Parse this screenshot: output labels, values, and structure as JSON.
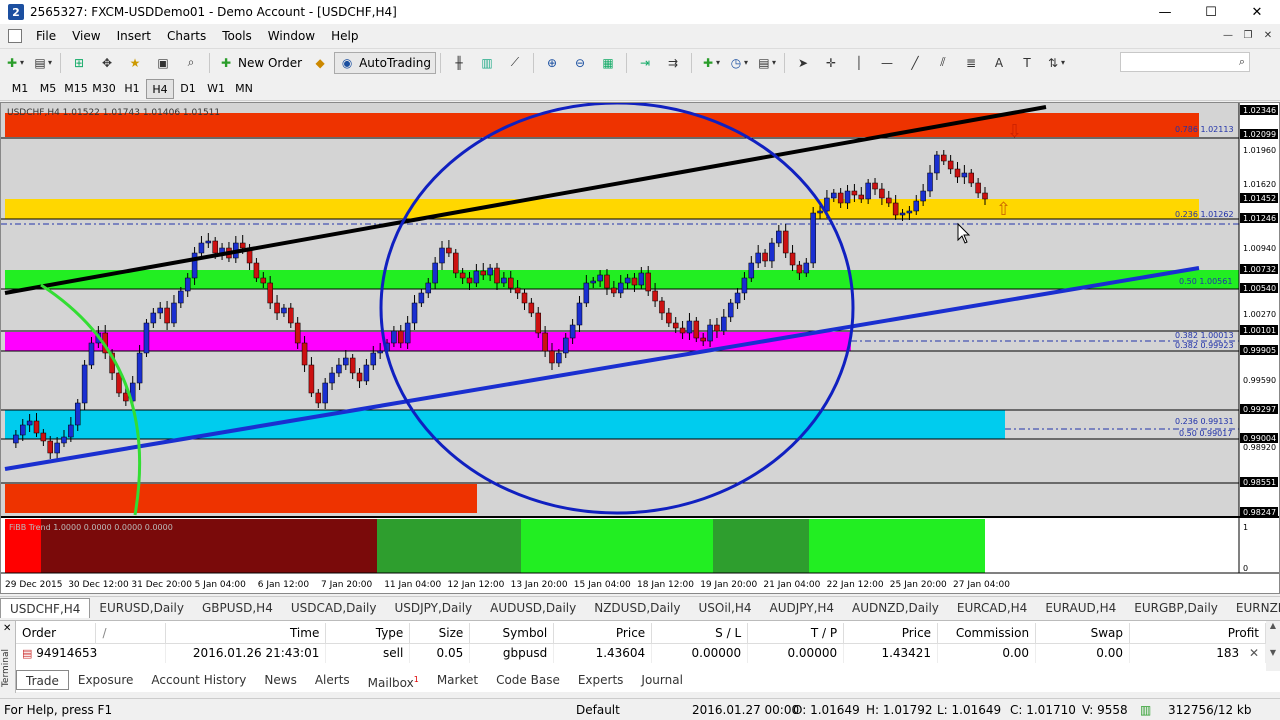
{
  "window": {
    "title": "2565327: FXCM-USDDemo01 - Demo Account - [USDCHF,H4]",
    "app_icon_letter": "2",
    "controls": [
      "—",
      "☐",
      "✕"
    ]
  },
  "menu": {
    "items": [
      "File",
      "View",
      "Insert",
      "Charts",
      "Tools",
      "Window",
      "Help"
    ],
    "mdi_controls": [
      "—",
      "❐",
      "✕"
    ]
  },
  "toolbar": {
    "new_order_label": "New Order",
    "autotrading_label": "AutoTrading",
    "search_icon": "magnifier-icon"
  },
  "timeframes": {
    "items": [
      "M1",
      "M5",
      "M15",
      "M30",
      "H1",
      "H4",
      "D1",
      "W1",
      "MN"
    ],
    "active": "H4"
  },
  "chart": {
    "header_text": "USDCHF,H4  1.01522 1.01743 1.01406 1.01511",
    "indicator_label": "FiBB Trend 1.0000 0.0000 0.0000 0.0000",
    "price_labels": [
      "1.02346",
      "1.02099",
      "1.01960",
      "1.01620",
      "1.01452",
      "1.01246",
      "1.00940",
      "1.00732",
      "1.00540",
      "1.00270",
      "1.00101",
      "0.99905",
      "0.99590",
      "0.99297",
      "0.99004",
      "0.98920",
      "0.98551",
      "0.98247"
    ],
    "fib_labels": [
      "0.786  1.02113",
      "0.236  1.01262",
      "0.50  1.00561",
      "0.382  1.00013",
      "0.382  0.99923",
      "0.236  0.99131",
      "0.50  0.99017"
    ],
    "time_labels": [
      "29 Dec 2015",
      "30 Dec 12:00",
      "31 Dec 20:00",
      "5 Jan 04:00",
      "6 Jan 12:00",
      "7 Jan 20:00",
      "11 Jan 04:00",
      "12 Jan 12:00",
      "13 Jan 20:00",
      "15 Jan 04:00",
      "18 Jan 12:00",
      "19 Jan 20:00",
      "21 Jan 04:00",
      "22 Jan 12:00",
      "25 Jan 20:00",
      "27 Jan 04:00"
    ],
    "indicator_scale_top": "1",
    "indicator_scale_bottom": "0",
    "colors": {
      "red_zone": "#ee3300",
      "yellow_zone": "#ffd700",
      "green_zone": "#22ee22",
      "magenta_zone": "#ff00ff",
      "cyan_zone": "#00ccee",
      "circle": "#1020c0",
      "trendline_blue": "#1a2fd0",
      "trendline_black": "#000000"
    }
  },
  "doc_tabs": {
    "items": [
      "USDCHF,H4",
      "EURUSD,Daily",
      "GBPUSD,H4",
      "USDCAD,Daily",
      "USDJPY,Daily",
      "AUDUSD,Daily",
      "NZDUSD,Daily",
      "USOil,H4",
      "AUDJPY,H4",
      "AUDNZD,Daily",
      "EURCAD,H4",
      "EURAUD,H4",
      "EURGBP,Daily",
      "EURNZD,Dail"
    ],
    "active": "USDCHF,H4"
  },
  "terminal": {
    "side_label": "Terminal",
    "columns": [
      "Order",
      "/",
      "Time",
      "Type",
      "Size",
      "Symbol",
      "Price",
      "S / L",
      "T / P",
      "Price",
      "Commission",
      "Swap",
      "Profit"
    ],
    "rows": [
      {
        "order": "94914653",
        "time": "2016.01.26 21:43:01",
        "type": "sell",
        "size": "0.05",
        "symbol": "gbpusd",
        "price": "1.43604",
        "sl": "0.00000",
        "tp": "0.00000",
        "price2": "1.43421",
        "commission": "0.00",
        "swap": "0.00",
        "profit": "183"
      }
    ],
    "tabs": [
      "Trade",
      "Exposure",
      "Account History",
      "News",
      "Alerts",
      "Mailbox",
      "Market",
      "Code Base",
      "Experts",
      "Journal"
    ],
    "active_tab": "Trade",
    "mailbox_badge": "1"
  },
  "status": {
    "help": "For Help, press F1",
    "profile": "Default",
    "datetime": "2016.01.27 00:00",
    "open": "O: 1.01649",
    "high": "H: 1.01792",
    "low": "L: 1.01649",
    "close": "C: 1.01710",
    "volume": "V: 9558",
    "traffic": "312756/12 kb"
  }
}
